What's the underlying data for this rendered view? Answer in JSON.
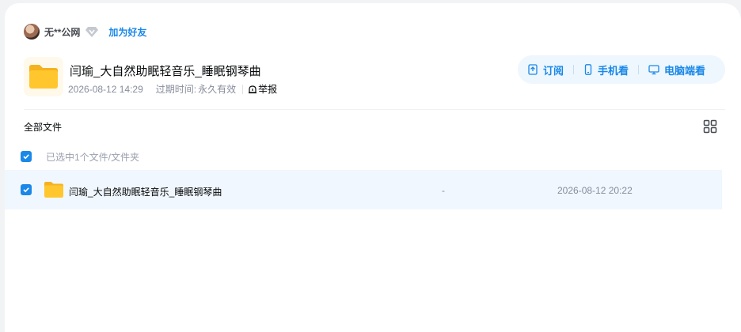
{
  "user": {
    "name": "无**公网",
    "add_friend_label": "加为好友"
  },
  "share": {
    "title": "闫瑜_大自然助眠轻音乐_睡眠钢琴曲",
    "created": "2026-08-12 14:29",
    "expire_label": "过期时间:",
    "expire_value": "永久有效",
    "report_label": "举报"
  },
  "actions": {
    "subscribe_label": "订阅",
    "phone_label": "手机看",
    "pc_label": "电脑端看"
  },
  "list": {
    "breadcrumb": "全部文件",
    "selection_status": "已选中1个文件/文件夹",
    "rows": [
      {
        "name": "闫瑜_大自然助眠轻音乐_睡眠钢琴曲",
        "size": "-",
        "date": "2026-08-12 20:22",
        "checked": true
      }
    ]
  },
  "colors": {
    "accent": "#1a88e8",
    "selected_row_bg": "#f0f7fe",
    "action_bar_bg": "#eef7fe",
    "folder_yellow": "#ffc62e"
  }
}
